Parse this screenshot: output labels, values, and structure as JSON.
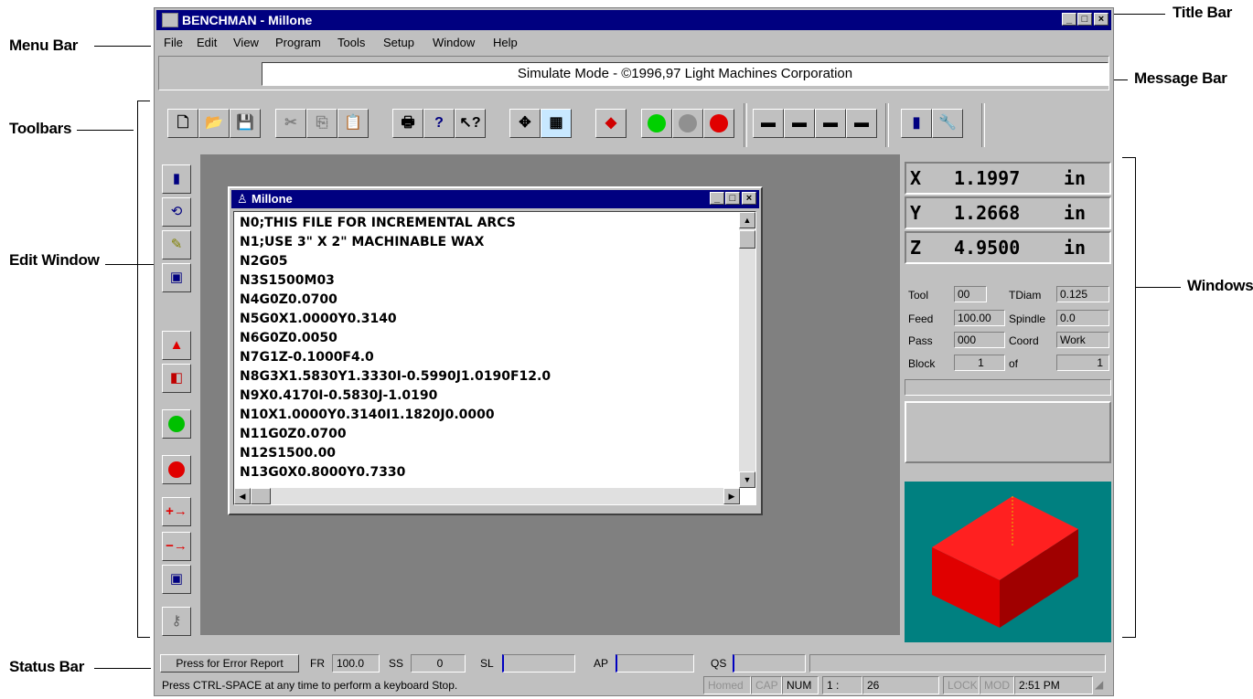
{
  "annotations": {
    "title_bar": "Title Bar",
    "menu_bar": "Menu Bar",
    "message_bar": "Message Bar",
    "toolbars": "Toolbars",
    "edit_window": "Edit Window",
    "windows": "Windows",
    "status_bar": "Status Bar"
  },
  "app": {
    "title": "BENCHMAN - Millone",
    "menu": [
      "File",
      "Edit",
      "View",
      "Program",
      "Tools",
      "Setup",
      "Window",
      "Help"
    ],
    "message": "Simulate Mode - ©1996,97 Light Machines Corporation"
  },
  "edit_window": {
    "title": "Millone",
    "lines": [
      "N0;THIS FILE FOR INCREMENTAL ARCS",
      "N1;USE 3\" X 2\" MACHINABLE WAX",
      "N2G05",
      "N3S1500M03",
      "N4G0Z0.0700",
      "N5G0X1.0000Y0.3140",
      "N6G0Z0.0050",
      "N7G1Z-0.1000F4.0",
      "N8G3X1.5830Y1.3330I-0.5990J1.0190F12.0",
      "N9X0.4170I-0.5830J-1.0190",
      "N10X1.0000Y0.3140I1.1820J0.0000",
      "N11G0Z0.0700",
      "N12S1500.00",
      "N13G0X0.8000Y0.7330"
    ]
  },
  "position": {
    "x": {
      "axis": "X",
      "value": "1.1997",
      "unit": "in"
    },
    "y": {
      "axis": "Y",
      "value": "1.2668",
      "unit": "in"
    },
    "z": {
      "axis": "Z",
      "value": "4.9500",
      "unit": "in"
    }
  },
  "info": {
    "tool_label": "Tool",
    "tool": "00",
    "tdiam_label": "TDiam",
    "tdiam": "0.125",
    "feed_label": "Feed",
    "feed": "100.00",
    "spindle_label": "Spindle",
    "spindle": "0.0",
    "pass_label": "Pass",
    "pass": "000",
    "coord_label": "Coord",
    "coord": "Work",
    "block_label": "Block",
    "block": "1",
    "of_label": "of",
    "of": "1"
  },
  "status": {
    "error_button": "Press for Error Report",
    "fr_label": "FR",
    "fr": "100.0",
    "ss_label": "SS",
    "ss": "0",
    "sl_label": "SL",
    "ap_label": "AP",
    "qs_label": "QS",
    "hint": "Press CTRL-SPACE at any time to perform a keyboard Stop.",
    "homed": "Homed",
    "cap": "CAP",
    "num": "NUM",
    "line": "1 :",
    "col": "26",
    "lock": "LOCK",
    "mod": "MOD",
    "time": "2:51 PM"
  },
  "colors": {
    "titlebar": "#000080",
    "block3d": "#e00000",
    "view_bg": "#008080"
  }
}
